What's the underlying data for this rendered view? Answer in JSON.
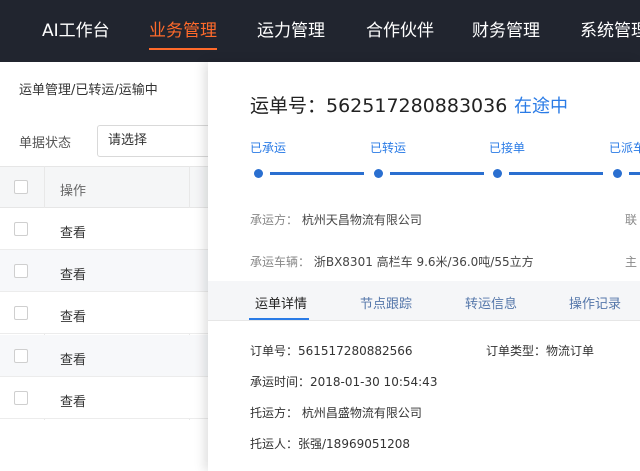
{
  "nav": {
    "items": [
      {
        "label": "AI工作台"
      },
      {
        "label": "业务管理"
      },
      {
        "label": "运力管理"
      },
      {
        "label": "合作伙伴"
      },
      {
        "label": "财务管理"
      },
      {
        "label": "系统管理"
      }
    ],
    "active_index": 1
  },
  "list": {
    "breadcrumb": "运单管理/已转运/运输中",
    "filter_label": "单据状态",
    "filter_placeholder": "请选择",
    "column_operation": "操作",
    "rows": [
      {
        "action": "查看"
      },
      {
        "action": "查看"
      },
      {
        "action": "查看"
      },
      {
        "action": "查看"
      },
      {
        "action": "查看"
      }
    ]
  },
  "drawer": {
    "title": "运单号：562517280883036",
    "status": "在途中",
    "steps": [
      "已承运",
      "已转运",
      "已接单",
      "已派车"
    ],
    "carrier_label": "承运方：",
    "carrier_value": "杭州天昌物流有限公司",
    "carrier_right_clip": "联",
    "vehicle_label": "承运车辆：",
    "vehicle_value": "浙BX8301  高栏车  9.6米/36.0吨/55立方",
    "vehicle_right_clip": "主",
    "tabs": [
      "运单详情",
      "节点跟踪",
      "转运信息",
      "操作记录"
    ],
    "details": {
      "order_no": "订单号：561517280882566",
      "order_type": "订单类型：物流订单",
      "carry_time": "承运时间：2018-01-30 10:54:43",
      "shipper": "托运方：  杭州昌盛物流有限公司",
      "consignor": "托运人：张强/18969051208"
    }
  }
}
